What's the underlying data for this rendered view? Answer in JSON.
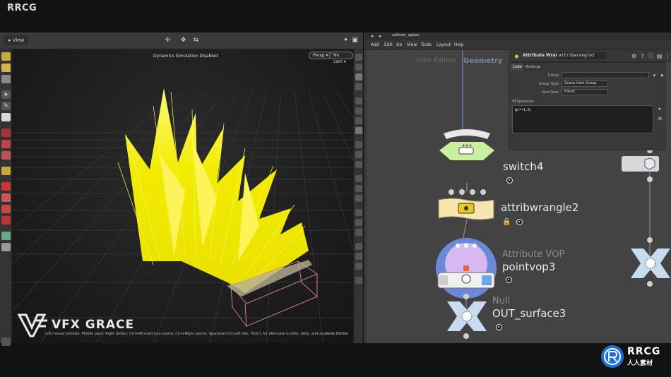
{
  "branding": {
    "top_left": "RRCG",
    "vfx_logo_text": "VFX GRACE",
    "corner_logo_top": "RRCG",
    "corner_logo_bottom": "人人素材"
  },
  "viewport": {
    "tab_label": "View",
    "status": "Dynamics Simulation Disabled",
    "persp_button": "Persp ▾",
    "cam_button": "No cam ▾",
    "help_text": "Left mouse tumbles. Middle pans. Right dollies. Ctrl+Alt+Left box-zooms. Ctrl+Right zooms. Spacebar-Ctrl-Left tilts. Hold L for alternate tumble, dolly, and zoom.",
    "edition_label": "Indie Edition",
    "colors": {
      "hair": "#f2ec00",
      "hair_tip": "#fff35a",
      "bbox": "#c87a9a",
      "background": "#1c1c1c"
    }
  },
  "network": {
    "path": "collision_splash",
    "menu": [
      "Add",
      "Edit",
      "Go",
      "View",
      "Tools",
      "Layout",
      "Help"
    ],
    "edition_label": "Indie Edition",
    "context_label": "Geometry",
    "nodes": [
      {
        "id": "switch",
        "label": "switch4",
        "type_label": ""
      },
      {
        "id": "attribwrangle",
        "label": "attribwrangle2",
        "type_label": ""
      },
      {
        "id": "pointvop",
        "label": "pointvop3",
        "type_label": "Attribute VOP"
      },
      {
        "id": "null",
        "label": "OUT_surface3",
        "type_label": "Null"
      }
    ],
    "colors": {
      "switch": "#c8f0a0",
      "wrangle": "#f5e6b0",
      "vop_outer": "#6a8ad8",
      "vop_inner": "#d8b8f0",
      "null": "#c8dcf0",
      "wire": "#9a9a9a"
    }
  },
  "parameters": {
    "node_type": "Attribute Wrangle",
    "node_name": "attribwrangle2",
    "tabs": [
      "Code",
      "Bindings"
    ],
    "active_tab": "Code",
    "rows": [
      {
        "label": "Group",
        "value": ""
      },
      {
        "label": "Group Type",
        "value": "Guess from Group"
      },
      {
        "label": "Run Over",
        "value": "Points"
      }
    ],
    "vex_label": "VEXpression",
    "vex_code": "@v*=1.6;"
  }
}
